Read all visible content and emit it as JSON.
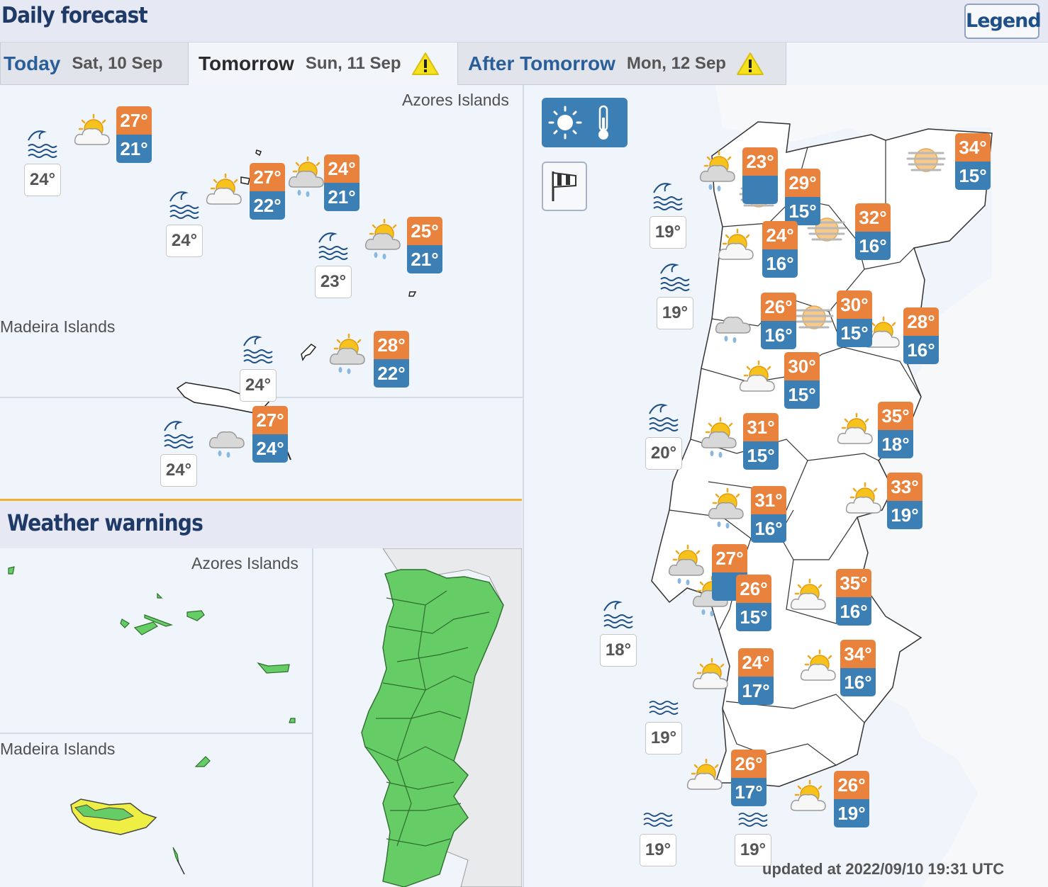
{
  "header": {
    "title": "Daily forecast",
    "legend_label": "Legend"
  },
  "tabs": [
    {
      "label": "Today",
      "date": "Sat, 10 Sep",
      "warning": false,
      "active": false
    },
    {
      "label": "Tomorrow",
      "date": "Sun, 11 Sep",
      "warning": true,
      "active": true
    },
    {
      "label": "After Tomorrow",
      "date": "Mon, 12 Sep",
      "warning": true,
      "active": false
    }
  ],
  "regions": {
    "azores": "Azores Islands",
    "madeira": "Madeira Islands"
  },
  "warnings": {
    "title": "Weather warnings",
    "azores_label": "Azores Islands",
    "madeira_label": "Madeira Islands",
    "colors": {
      "green": "#66cc66",
      "yellow": "#eeee44"
    }
  },
  "colors": {
    "max_temp": "#e9823c",
    "min_temp": "#3c7fb4",
    "accent": "#2a5e98"
  },
  "forecast_stations": [
    {
      "max": "27",
      "min": "21",
      "icon": "sun-cloud-icon"
    },
    {
      "max": "27",
      "min": "22",
      "icon": "sun-cloud-icon"
    },
    {
      "max": "24",
      "min": "21",
      "icon": "sun-cloud-rain-icon"
    },
    {
      "max": "25",
      "min": "21",
      "icon": "sun-cloud-rain-icon"
    },
    {
      "max": "28",
      "min": "22",
      "icon": "sun-cloud-rain-icon"
    },
    {
      "max": "27",
      "min": "24",
      "icon": "cloud-rain-icon"
    },
    {
      "max": "23",
      "min": "",
      "icon": "sun-cloud-rain-icon"
    },
    {
      "max": "29",
      "min": "15",
      "icon": "haze-icon"
    },
    {
      "max": "34",
      "min": "15",
      "icon": "haze-icon"
    },
    {
      "max": "32",
      "min": "16",
      "icon": "haze-icon"
    },
    {
      "max": "24",
      "min": "16",
      "icon": "sun-cloud-icon"
    },
    {
      "max": "26",
      "min": "16",
      "icon": "cloud-rain-icon"
    },
    {
      "max": "30",
      "min": "15",
      "icon": "haze-icon"
    },
    {
      "max": "28",
      "min": "16",
      "icon": "sun-cloud-icon"
    },
    {
      "max": "30",
      "min": "15",
      "icon": "sun-cloud-icon"
    },
    {
      "max": "31",
      "min": "15",
      "icon": "sun-cloud-rain-icon"
    },
    {
      "max": "35",
      "min": "18",
      "icon": "sun-cloud-icon"
    },
    {
      "max": "31",
      "min": "16",
      "icon": "sun-cloud-rain-icon"
    },
    {
      "max": "33",
      "min": "19",
      "icon": "sun-cloud-icon"
    },
    {
      "max": "27",
      "min": "",
      "icon": "sun-cloud-rain-icon"
    },
    {
      "max": "26",
      "min": "15",
      "icon": "sun-cloud-rain-icon"
    },
    {
      "max": "35",
      "min": "16",
      "icon": "sun-cloud-icon"
    },
    {
      "max": "24",
      "min": "17",
      "icon": "sun-cloud-icon"
    },
    {
      "max": "34",
      "min": "16",
      "icon": "sun-cloud-icon"
    },
    {
      "max": "26",
      "min": "17",
      "icon": "sun-cloud-icon"
    },
    {
      "max": "26",
      "min": "19",
      "icon": "sun-cloud-icon"
    }
  ],
  "sea_temps": [
    {
      "value": "24",
      "icon": "wave-icon"
    },
    {
      "value": "24",
      "icon": "wave-icon"
    },
    {
      "value": "23",
      "icon": "wave-icon"
    },
    {
      "value": "24",
      "icon": "wave-icon"
    },
    {
      "value": "24",
      "icon": "wave-icon"
    },
    {
      "value": "19",
      "icon": "wave-icon"
    },
    {
      "value": "19",
      "icon": "wave-icon"
    },
    {
      "value": "20",
      "icon": "wave-icon"
    },
    {
      "value": "18",
      "icon": "wave-icon"
    },
    {
      "value": "19",
      "icon": "ripple-icon"
    },
    {
      "value": "19",
      "icon": "ripple-icon"
    },
    {
      "value": "19",
      "icon": "ripple-icon"
    }
  ],
  "updated": "updated at 2022/09/10 19:31 UTC"
}
